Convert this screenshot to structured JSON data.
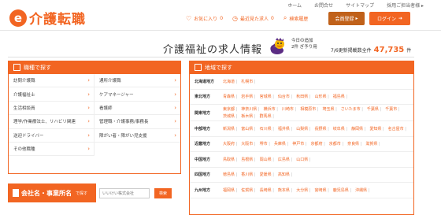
{
  "logo": {
    "mark": "e",
    "text": "介護転職"
  },
  "toplinks": [
    "ホーム",
    "お問合せ",
    "サイトマップ",
    "採用ご担当者様 ▸"
  ],
  "util": {
    "favorites_label": "お気に入り",
    "favorites_count": "0",
    "history_label": "最近見た求人",
    "history_count": "0",
    "search_label": "検索履歴"
  },
  "buttons": {
    "register": "会員登録",
    "login": "ログイン"
  },
  "title": {
    "heading": "介護福祉の求人情報",
    "today_label": "今日の追加",
    "today_count": "2件 ぎ予り用",
    "total_label": "7/6更新掲載数全件",
    "total_count": "47,735",
    "total_unit": "件"
  },
  "job_panel": {
    "title": "職種で探す",
    "subtitle": "で探す",
    "items": [
      "訪問介護職",
      "通所介護職",
      "介護福祉士",
      "ケアマネージャー",
      "生活相談員",
      "看護師",
      "理学/作業療法士、リハビリ関連",
      "管理職・介護事務/事務長",
      "送迎ドライバー",
      "障がい者・障がい児支援",
      "その他職種"
    ]
  },
  "region_panel": {
    "title": "地域で探す",
    "subtitle": "で探す",
    "regions": [
      {
        "name": "北海道地方",
        "prefs": [
          "北海道",
          "札幌市"
        ]
      },
      {
        "name": "東北地方",
        "prefs": [
          "青森県",
          "岩手県",
          "宮城県",
          "仙台市",
          "秋田県",
          "山形県",
          "福島県"
        ]
      },
      {
        "name": "関東地方",
        "prefs": [
          "東京都",
          "神奈川県",
          "横浜市",
          "川崎市",
          "相模原市",
          "埼玉県",
          "さいたま市",
          "千葉県",
          "千葉市",
          "茨城県",
          "栃木県",
          "群馬県"
        ]
      },
      {
        "name": "中部地方",
        "prefs": [
          "新潟県",
          "富山県",
          "石川県",
          "福井県",
          "山梨県",
          "長野県",
          "岐阜県",
          "静岡県",
          "愛知県",
          "名古屋市"
        ]
      },
      {
        "name": "近畿地方",
        "prefs": [
          "大阪府",
          "大阪市",
          "堺市",
          "兵庫県",
          "神戸市",
          "京都府",
          "京都市",
          "奈良県",
          "滋賀県"
        ]
      },
      {
        "name": "中国地方",
        "prefs": [
          "鳥取県",
          "島根県",
          "岡山県",
          "広島県",
          "山口県"
        ]
      },
      {
        "name": "四国地方",
        "prefs": [
          "徳島県",
          "香川県",
          "愛媛県",
          "高知県"
        ]
      },
      {
        "name": "九州地方",
        "prefs": [
          "福岡県",
          "佐賀県",
          "長崎県",
          "熊本県",
          "大分県",
          "宮崎県",
          "鹿児島県",
          "沖縄県"
        ]
      }
    ]
  },
  "company_search": {
    "label": "会社名・事業所名",
    "sub": "で探す",
    "placeholder": "いいけい株式会社",
    "button": "検索"
  },
  "colors": {
    "accent": "#f26522",
    "register_btn": "#c0611a"
  }
}
